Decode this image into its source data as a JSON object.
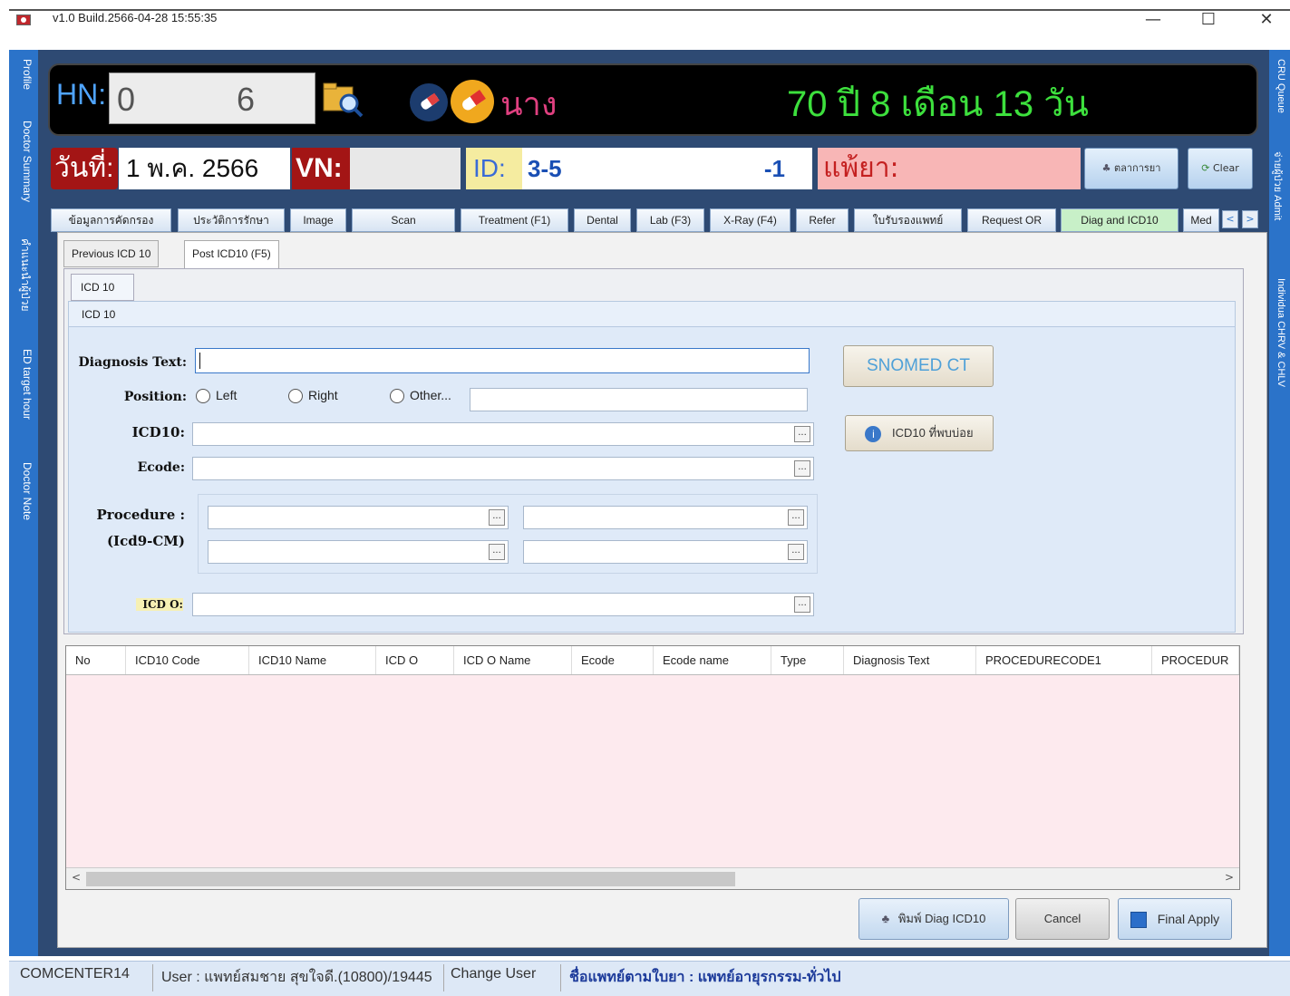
{
  "window": {
    "title": "v1.0 Build.2566-04-28 15:55:35",
    "minimize": "—",
    "maximize": "☐",
    "close": "✕"
  },
  "sidebar_left": [
    "Profile",
    "Doctor Summary",
    "คำแนะนำผู้ป่วย",
    "ED target hour",
    "Doctor Note"
  ],
  "sidebar_right": [
    "CRU Queue",
    "จ่ายผู้ป่วย Admit",
    "Individua CHRV & CHLV"
  ],
  "header": {
    "hn_label": "HN:",
    "hn_part1": "0",
    "hn_part2": "6",
    "title_prefix": "นาง",
    "age": "70 ปี  8 เดือน  13 วัน"
  },
  "visit": {
    "date_label": "วันที่:",
    "date_value": "1 พ.ค. 2566",
    "vn_label": "VN:",
    "vn_value": "",
    "id_label": "ID:",
    "id_value": "3-5",
    "id_suffix": "-1",
    "allergy_label": "แพ้ยา:",
    "drug_button": "ตลาการยา",
    "clear_button": "Clear"
  },
  "tabs": [
    "ข้อมูลการคัดกรอง",
    "ประวัติการรักษา",
    "Image",
    "Scan",
    "Treatment (F1)",
    "Dental",
    "Lab (F3)",
    "X-Ray (F4)",
    "Refer",
    "ใบรับรองแพทย์",
    "Request OR",
    "Diag and ICD10",
    "Med"
  ],
  "tab_arrows": [
    "<",
    ">"
  ],
  "subtabs": [
    "Previous ICD 10",
    "Post ICD10 (F5)"
  ],
  "icd_panel": {
    "tab_label": "ICD 10",
    "header": "ICD 10",
    "diagnosis_label": "Diagnosis Text:",
    "position_label": "Position:",
    "position_options": [
      "Left",
      "Right",
      "Other..."
    ],
    "icd10_label": "ICD10:",
    "ecode_label": "Ecode:",
    "procedure_label": "Procedure :",
    "procedure_sub": "(Icd9-CM)",
    "icdo_label": "ICD O:",
    "snomed_button": "SNOMED CT",
    "icd10_extra_button": "ICD10 ที่พบบ่อย",
    "ellipsis": "..."
  },
  "grid": {
    "columns": [
      "No",
      "ICD10  Code",
      "ICD10  Name",
      "ICD O",
      "ICD O Name",
      "Ecode",
      "Ecode name",
      "Type",
      "Diagnosis Text",
      "PROCEDURECODE1",
      "PROCEDUR"
    ],
    "scroll_left": "<",
    "scroll_right": ">"
  },
  "actions": {
    "print_button": "พิมพ์ Diag ICD10",
    "cancel_button": "Cancel",
    "final_button": "Final Apply"
  },
  "status": {
    "machine": "COMCENTER14",
    "user": "User : แพทย์สมชาย สุขใจดี.(10800)/19445",
    "change_user": "Change User",
    "doctor": "ชื่อแพทย์ตามใบยา : แพทย์อายุรกรรม-ทั่วไป"
  },
  "colors": {
    "sidebar": "#2b73c9",
    "header_bg": "#000000",
    "age_green": "#3de03d",
    "label_red": "#a31515",
    "allergy_bg": "#f8b6b6",
    "form_bg": "#dfeaf8",
    "grid_bg": "#fdeaee"
  }
}
